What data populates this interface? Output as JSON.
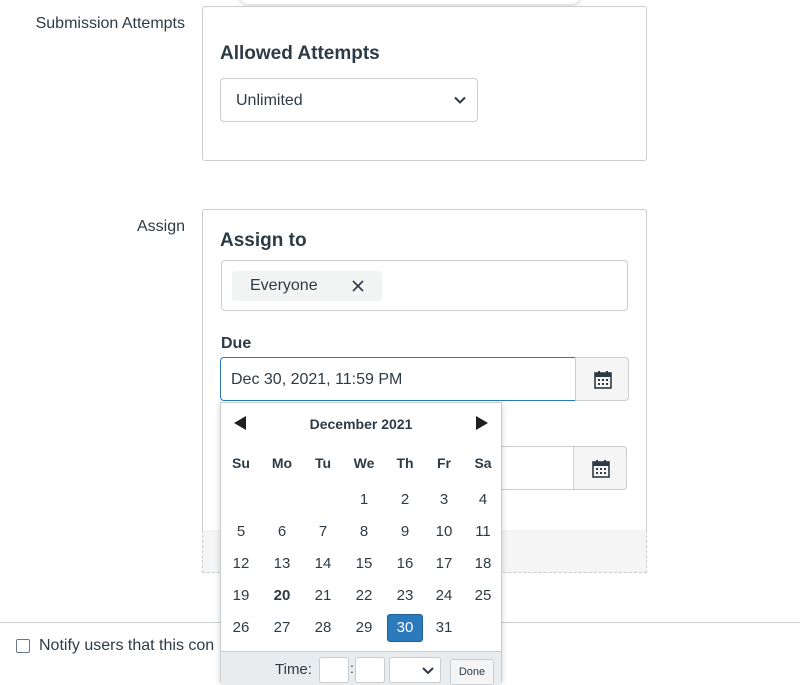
{
  "submission_attempts": {
    "row_label": "Submission Attempts",
    "card_title": "Allowed Attempts",
    "select_value": "Unlimited"
  },
  "assign": {
    "row_label": "Assign",
    "card_title": "Assign to",
    "token_label": "Everyone",
    "due_label": "Due",
    "due_value": "Dec 30, 2021, 11:59 PM"
  },
  "datepicker": {
    "month_title": "December 2021",
    "weekdays": [
      "Su",
      "Mo",
      "Tu",
      "We",
      "Th",
      "Fr",
      "Sa"
    ],
    "weeks": [
      [
        "",
        "",
        "",
        "1",
        "2",
        "3",
        "4"
      ],
      [
        "5",
        "6",
        "7",
        "8",
        "9",
        "10",
        "11"
      ],
      [
        "12",
        "13",
        "14",
        "15",
        "16",
        "17",
        "18"
      ],
      [
        "19",
        "20",
        "21",
        "22",
        "23",
        "24",
        "25"
      ],
      [
        "26",
        "27",
        "28",
        "29",
        "30",
        "31",
        ""
      ]
    ],
    "today": "20",
    "selected": "30",
    "time_label": "Time:",
    "time_separator": ":",
    "done_label": "Done"
  },
  "notify": {
    "label": "Notify users that this con"
  },
  "colors": {
    "accent": "#2b7abc",
    "text": "#2d3b45",
    "border": "#c7cdd1"
  },
  "icons": {
    "select": "chevron-down-icon",
    "token_remove": "close-icon",
    "date_picker": "calendar-icon",
    "prev_month": "triangle-left-icon",
    "next_month": "triangle-right-icon"
  }
}
